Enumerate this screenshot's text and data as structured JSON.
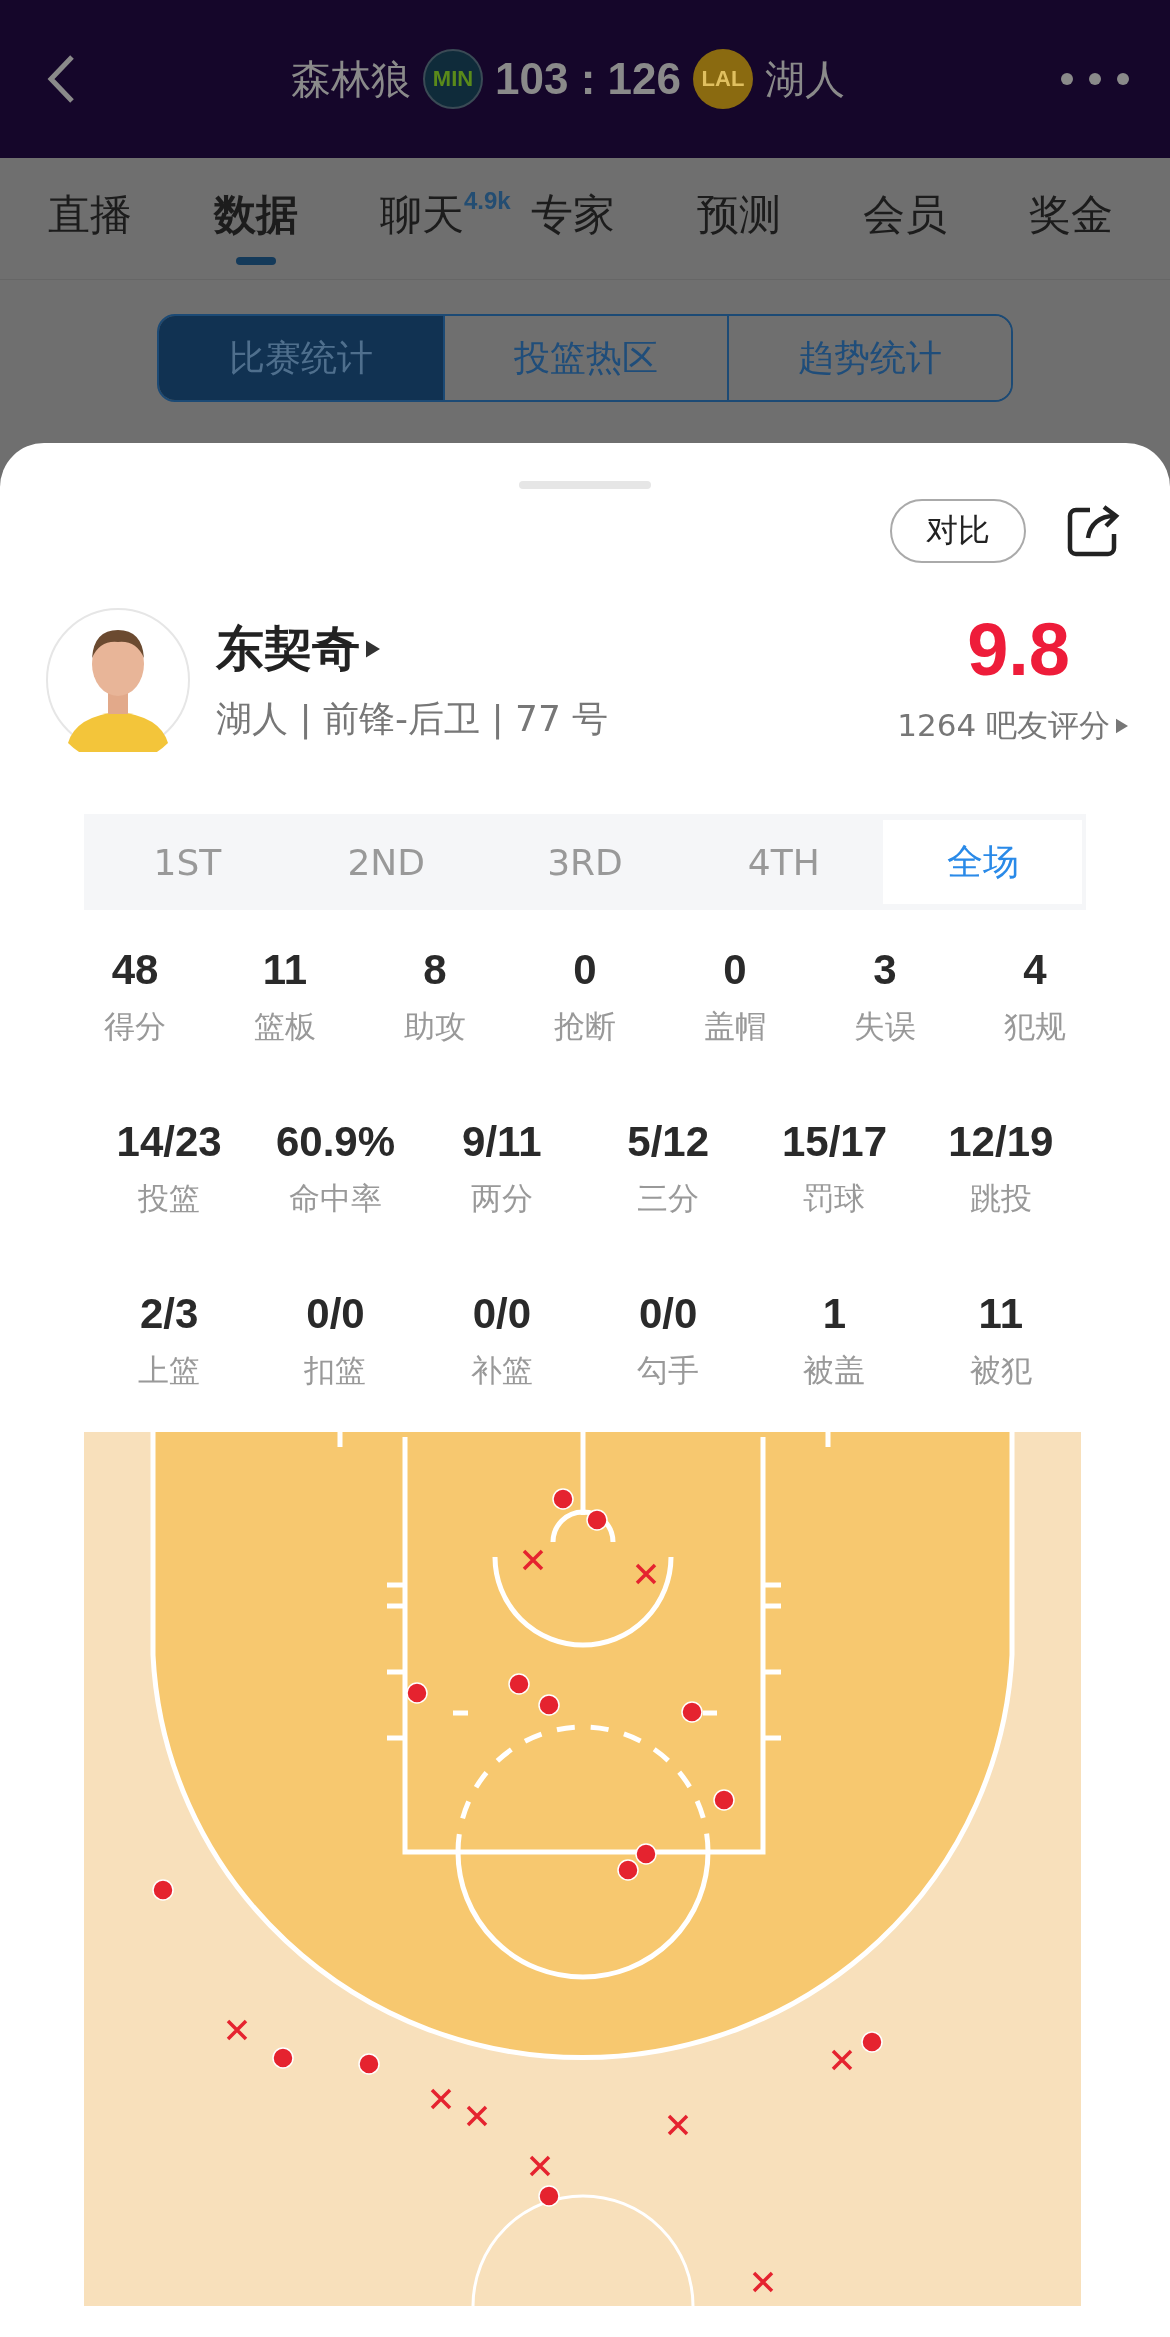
{
  "header": {
    "home_team": "森林狼",
    "home_logo": "MIN",
    "score": "103 : 126",
    "away_logo": "LAL",
    "away_team": "湖人"
  },
  "tabs": [
    {
      "label": "直播",
      "selected": false
    },
    {
      "label": "数据",
      "selected": true
    },
    {
      "label": "聊天",
      "badge": "4.9k",
      "selected": false
    },
    {
      "label": "专家",
      "selected": false
    },
    {
      "label": "预测",
      "selected": false
    },
    {
      "label": "会员",
      "selected": false
    },
    {
      "label": "奖金",
      "selected": false
    }
  ],
  "segments": [
    {
      "label": "比赛统计",
      "selected": true
    },
    {
      "label": "投篮热区",
      "selected": false
    },
    {
      "label": "趋势统计",
      "selected": false
    }
  ],
  "compare_button": "对比",
  "player": {
    "name": "东契奇",
    "info": "湖人 | 前锋-后卫 | 77 号",
    "rating": "9.8",
    "rating_count": "1264 吧友评分"
  },
  "periods": [
    {
      "label": "1ST",
      "selected": false
    },
    {
      "label": "2ND",
      "selected": false
    },
    {
      "label": "3RD",
      "selected": false
    },
    {
      "label": "4TH",
      "selected": false
    },
    {
      "label": "全场",
      "selected": true
    }
  ],
  "stat_rows": [
    [
      {
        "value": "48",
        "label": "得分"
      },
      {
        "value": "11",
        "label": "篮板"
      },
      {
        "value": "8",
        "label": "助攻"
      },
      {
        "value": "0",
        "label": "抢断"
      },
      {
        "value": "0",
        "label": "盖帽"
      },
      {
        "value": "3",
        "label": "失误"
      },
      {
        "value": "4",
        "label": "犯规"
      }
    ],
    [
      {
        "value": "14/23",
        "label": "投篮"
      },
      {
        "value": "60.9%",
        "label": "命中率"
      },
      {
        "value": "9/11",
        "label": "两分"
      },
      {
        "value": "5/12",
        "label": "三分"
      },
      {
        "value": "15/17",
        "label": "罚球"
      },
      {
        "value": "12/19",
        "label": "跳投"
      }
    ],
    [
      {
        "value": "2/3",
        "label": "上篮"
      },
      {
        "value": "0/0",
        "label": "扣篮"
      },
      {
        "value": "0/0",
        "label": "补篮"
      },
      {
        "value": "0/0",
        "label": "勾手"
      },
      {
        "value": "1",
        "label": "被盖"
      },
      {
        "value": "11",
        "label": "被犯"
      }
    ]
  ],
  "shot_chart": {
    "shots": [
      {
        "made": true
      },
      {
        "made": true
      },
      {
        "made": true
      },
      {
        "made": true
      },
      {
        "made": true
      },
      {
        "made": true
      },
      {
        "made": true
      },
      {
        "made": true
      },
      {
        "made": true
      },
      {
        "made": true
      },
      {
        "made": true
      },
      {
        "made": true
      },
      {
        "made": true
      },
      {
        "made": true
      },
      {
        "made": false
      },
      {
        "made": false
      },
      {
        "made": false
      },
      {
        "made": false
      },
      {
        "made": false
      },
      {
        "made": false
      },
      {
        "made": false
      },
      {
        "made": false
      },
      {
        "made": false
      }
    ]
  }
}
